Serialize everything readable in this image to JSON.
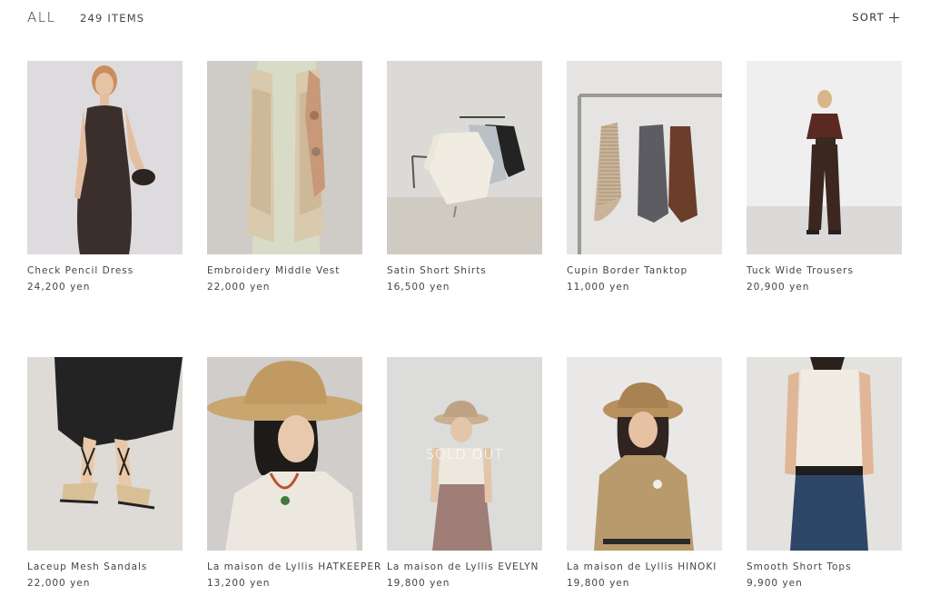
{
  "header": {
    "category": "ALL",
    "count": "249 ITEMS",
    "sort_label": "SORT"
  },
  "products": [
    {
      "name": "Check Pencil Dress",
      "price": "24,200 yen",
      "sold_out": false
    },
    {
      "name": "Embroidery Middle Vest",
      "price": "22,000 yen",
      "sold_out": false
    },
    {
      "name": "Satin Short Shirts",
      "price": "16,500 yen",
      "sold_out": false
    },
    {
      "name": "Cupin Border Tanktop",
      "price": "11,000 yen",
      "sold_out": false
    },
    {
      "name": "Tuck Wide Trousers",
      "price": "20,900 yen",
      "sold_out": false
    },
    {
      "name": "Laceup Mesh Sandals",
      "price": "22,000 yen",
      "sold_out": false
    },
    {
      "name": "La maison de Lyllis HATKEEPER",
      "price": "13,200 yen",
      "sold_out": false
    },
    {
      "name": "La maison de Lyllis EVELYN",
      "price": "19,800 yen",
      "sold_out": true,
      "badge": "SOLD OUT"
    },
    {
      "name": "La maison de Lyllis HINOKI",
      "price": "19,800 yen",
      "sold_out": false
    },
    {
      "name": "Smooth Short Tops",
      "price": "9,900 yen",
      "sold_out": false
    }
  ]
}
